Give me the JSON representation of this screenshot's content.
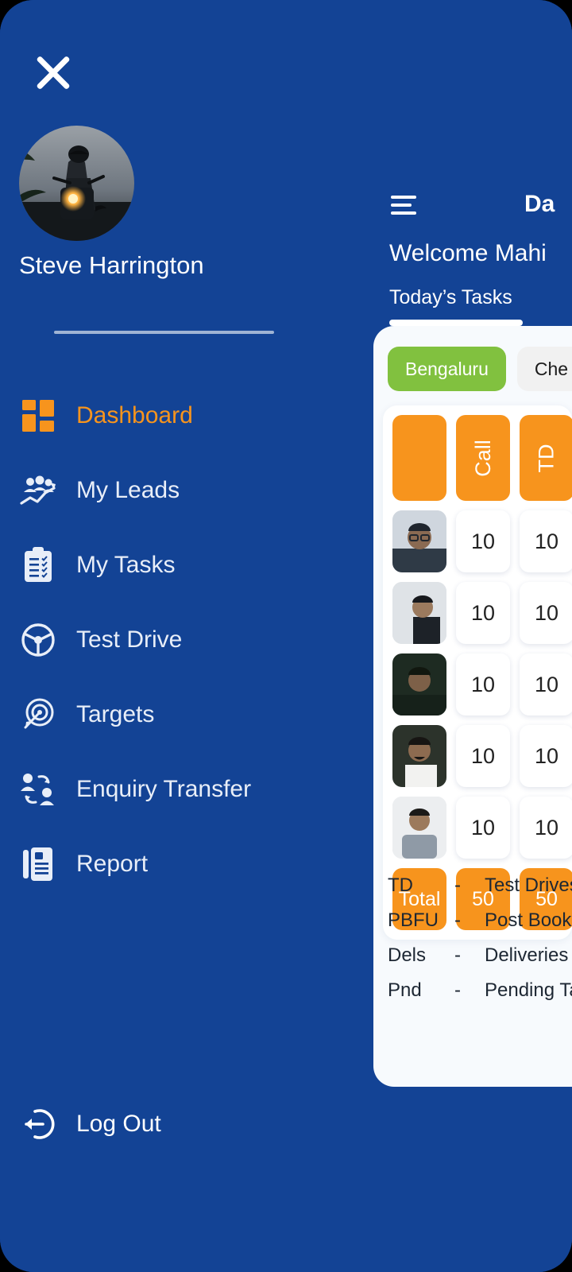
{
  "sidebar": {
    "close_icon": "close-icon",
    "avatar_icon": "user-avatar-motorcycle-photo",
    "username": "Steve Harrington",
    "items": [
      {
        "label": "Dashboard",
        "icon": "dashboard-grid-icon",
        "active": true
      },
      {
        "label": "My Leads",
        "icon": "leads-people-chart-icon",
        "active": false
      },
      {
        "label": "My Tasks",
        "icon": "clipboard-checklist-icon",
        "active": false
      },
      {
        "label": "Test Drive",
        "icon": "steering-wheel-icon",
        "active": false
      },
      {
        "label": "Targets",
        "icon": "target-arrow-icon",
        "active": false
      },
      {
        "label": "Enquiry Transfer",
        "icon": "transfer-people-icon",
        "active": false
      },
      {
        "label": "Report",
        "icon": "report-document-icon",
        "active": false
      }
    ],
    "logout": {
      "label": "Log Out",
      "icon": "logout-arrow-icon"
    }
  },
  "dashboard": {
    "menu_icon": "hamburger-menu-icon",
    "title": "Da",
    "welcome": "Welcome Mahi",
    "tab": "Today’s Tasks",
    "city_chips": [
      {
        "label": "Bengaluru",
        "active": true
      },
      {
        "label": "Che",
        "active": false
      }
    ],
    "table": {
      "headers": [
        "",
        "Call",
        "TD"
      ],
      "rows": [
        {
          "avatar": "person-avatar-1",
          "values": [
            "10",
            "10"
          ]
        },
        {
          "avatar": "person-avatar-2",
          "values": [
            "10",
            "10"
          ]
        },
        {
          "avatar": "person-avatar-3",
          "values": [
            "10",
            "10"
          ]
        },
        {
          "avatar": "person-avatar-4",
          "values": [
            "10",
            "10"
          ]
        },
        {
          "avatar": "person-avatar-5",
          "values": [
            "10",
            "10"
          ]
        }
      ],
      "total": {
        "label": "Total",
        "values": [
          "50",
          "50"
        ]
      }
    },
    "legend": [
      {
        "abbr": "TD",
        "dash": "-",
        "full": "Test Drives"
      },
      {
        "abbr": "PBFU",
        "dash": "-",
        "full": "Post Booking"
      },
      {
        "abbr": "Dels",
        "dash": "-",
        "full": "Deliveries"
      },
      {
        "abbr": "Pnd",
        "dash": "-",
        "full": "Pending Tasks"
      }
    ]
  },
  "colors": {
    "brand_blue": "#134395",
    "card_blue": "#3B5FA5",
    "accent_orange": "#F7941D",
    "active_green": "#81C13F",
    "sheet_bg": "#F7FAFD"
  }
}
